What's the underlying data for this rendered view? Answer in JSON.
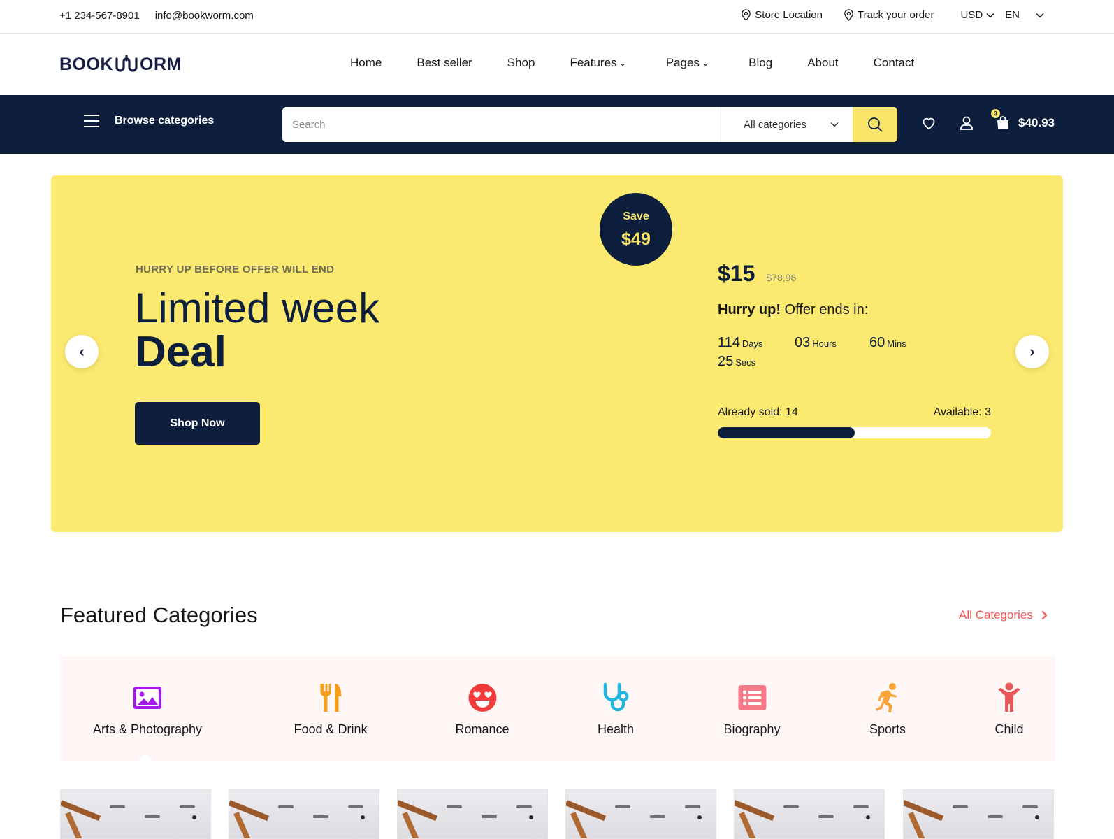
{
  "topbar": {
    "phone": "+1 234-567-8901",
    "email": "info@bookworm.com",
    "store_location": "Store Location",
    "track_order": "Track your order",
    "currency": "USD",
    "language": "EN"
  },
  "header": {
    "logo_left": "BOOK",
    "logo_right": "ORM",
    "nav": [
      {
        "label": "Home"
      },
      {
        "label": "Best seller"
      },
      {
        "label": "Shop"
      },
      {
        "label": "Features",
        "has_dropdown": true
      },
      {
        "label": "Pages",
        "has_dropdown": true
      },
      {
        "label": "Blog"
      },
      {
        "label": "About"
      },
      {
        "label": "Contact"
      }
    ]
  },
  "searchbar": {
    "browse_label": "Browse categories",
    "search_placeholder": "Search",
    "category_select": "All categories",
    "cart_count": "3",
    "cart_total": "$40.93"
  },
  "hero": {
    "kicker": "HURRY UP BEFORE OFFER WILL END",
    "title_line1": "Limited week",
    "title_line2": "Deal",
    "cta": "Shop Now",
    "save_label": "Save",
    "save_amount": "$49",
    "price_now": "$15",
    "price_old": "$78,96",
    "hurry_bold": "Hurry up!",
    "hurry_rest": " Offer ends in:",
    "timer": {
      "days": "114",
      "days_unit": "Days",
      "hours": "03",
      "hours_unit": "Hours",
      "mins": "60",
      "mins_unit": "Mins",
      "secs": "25",
      "secs_unit": "Secs"
    },
    "already_sold": "Already sold: 14",
    "available": "Available: 3",
    "sold_fraction": 0.5
  },
  "featured": {
    "title": "Featured Categories",
    "all_link": "All Categories",
    "categories": [
      {
        "label": "Arts & Photography",
        "icon": "image-icon",
        "color": "#a21ae8"
      },
      {
        "label": "Food & Drink",
        "icon": "fork-knife-icon",
        "color": "#f79e1b"
      },
      {
        "label": "Romance",
        "icon": "heart-eyes-smiley-icon",
        "color": "#f23b3b"
      },
      {
        "label": "Health",
        "icon": "stethoscope-icon",
        "color": "#1fb6e0"
      },
      {
        "label": "Biography",
        "icon": "list-icon",
        "color": "#f77b86"
      },
      {
        "label": "Sports",
        "icon": "runner-icon",
        "color": "#f7a43a"
      },
      {
        "label": "Child",
        "icon": "child-icon",
        "color": "#e8575a"
      }
    ]
  },
  "colors": {
    "navy": "#0d1f3d",
    "yellow": "#fbe970",
    "accent_red": "#f75454"
  }
}
